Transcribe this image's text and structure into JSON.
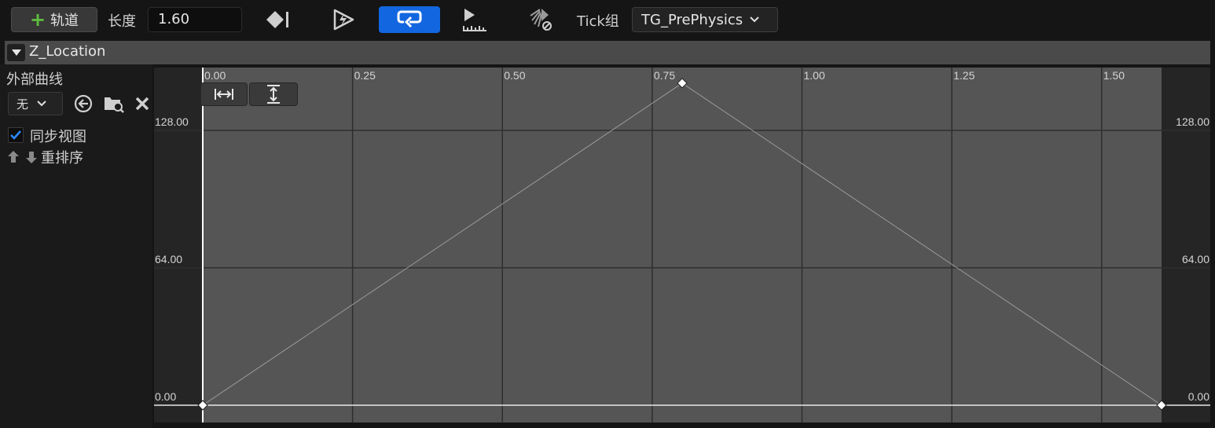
{
  "toolbar": {
    "add_track_label": "轨道",
    "length_label": "长度",
    "length_value": "1.60",
    "tick_group_label": "Tick组",
    "tick_group_value": "TG_PrePhysics"
  },
  "track": {
    "name": "Z_Location"
  },
  "left_panel": {
    "external_curve_label": "外部曲线",
    "external_curve_value": "无",
    "sync_view_label": "同步视图",
    "sync_view_checked": true,
    "reorder_label": "重排序"
  },
  "curve": {
    "time_ticks": [
      "0.00",
      "0.25",
      "0.50",
      "0.75",
      "1.00",
      "1.25",
      "1.50"
    ],
    "value_ticks": [
      "128.00",
      "64.00",
      "0.00"
    ],
    "keys": [
      {
        "time": 0.0,
        "value": 0.0
      },
      {
        "time": 0.8,
        "value": 150.0
      },
      {
        "time": 1.6,
        "value": 0.0
      }
    ]
  },
  "colors": {
    "accent": "#1266e0",
    "graph_bg": "#555555",
    "out_of_range_bg": "#252525",
    "add_icon": "#5fbf3f"
  }
}
